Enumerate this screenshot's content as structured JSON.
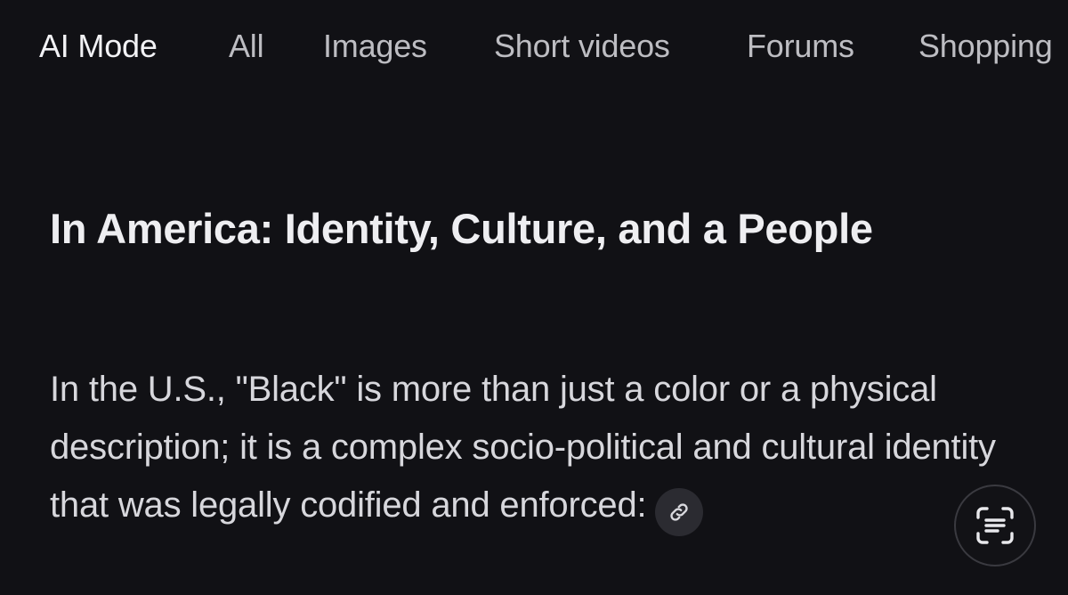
{
  "tabs": [
    {
      "label": "AI Mode",
      "active": true
    },
    {
      "label": "All",
      "active": false
    },
    {
      "label": "Images",
      "active": false
    },
    {
      "label": "Short videos",
      "active": false
    },
    {
      "label": "Forums",
      "active": false
    },
    {
      "label": "Shopping",
      "active": false
    }
  ],
  "content": {
    "heading": "In America: Identity, Culture, and a People",
    "paragraph": "In the U.S., \"Black\" is more than just a color or a physical description; it is a complex socio-political and cultural identity that was legally codified and enforced:",
    "citation_icon": "link-icon"
  },
  "fab": {
    "icon": "lens-text-scan-icon"
  },
  "colors": {
    "background": "#111115",
    "active_tab": "#f2f2f5",
    "inactive_tab": "#bdbdc2",
    "chip_background": "#2b2b31"
  }
}
